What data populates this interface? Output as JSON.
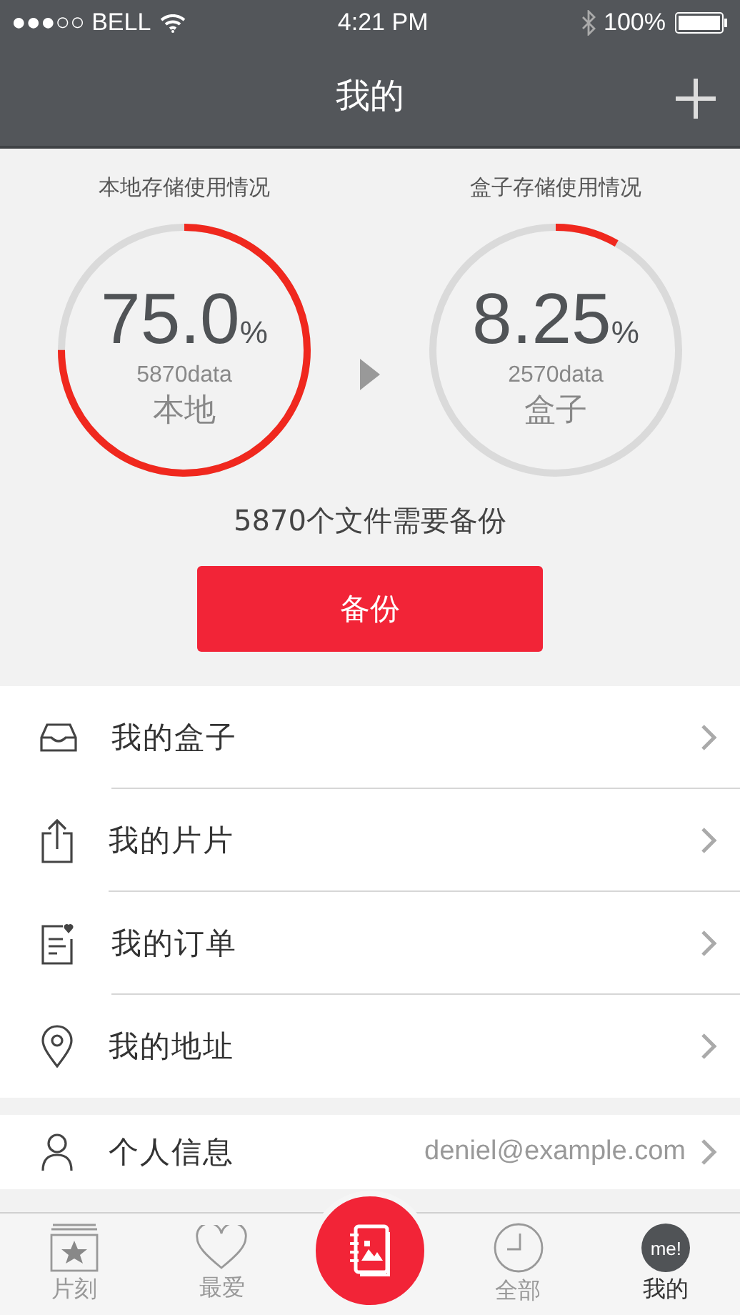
{
  "status_bar": {
    "carrier": "●●●○○ BELL",
    "time": "4:21 PM",
    "battery": "100%"
  },
  "nav": {
    "title": "我的"
  },
  "storage": [
    {
      "title": "本地存储使用情况",
      "value": "75.0",
      "unit": "%",
      "count": "5870data",
      "label": "本地"
    },
    {
      "title": "盒子存储使用情况",
      "value": "8.25",
      "unit": "%",
      "count": "2570data",
      "label": "盒子"
    }
  ],
  "backup_message": "5870个文件需要备份",
  "backup_button": "备份",
  "menu": [
    {
      "kind": "box",
      "label": "我的盒子"
    },
    {
      "kind": "share",
      "label": "我的片片"
    },
    {
      "kind": "order",
      "label": "我的订单"
    },
    {
      "kind": "location",
      "label": "我的地址"
    }
  ],
  "profile": {
    "label": "个人信息",
    "value": "deniel@example.com"
  },
  "tabs": [
    {
      "kind": "moments",
      "label": "片刻",
      "selected": false
    },
    {
      "kind": "favorites",
      "label": "最爱",
      "selected": false
    },
    {
      "kind": "album"
    },
    {
      "kind": "all",
      "label": "全部",
      "selected": false
    },
    {
      "kind": "me",
      "label": "我的",
      "badge": "me!",
      "selected": true
    }
  ]
}
